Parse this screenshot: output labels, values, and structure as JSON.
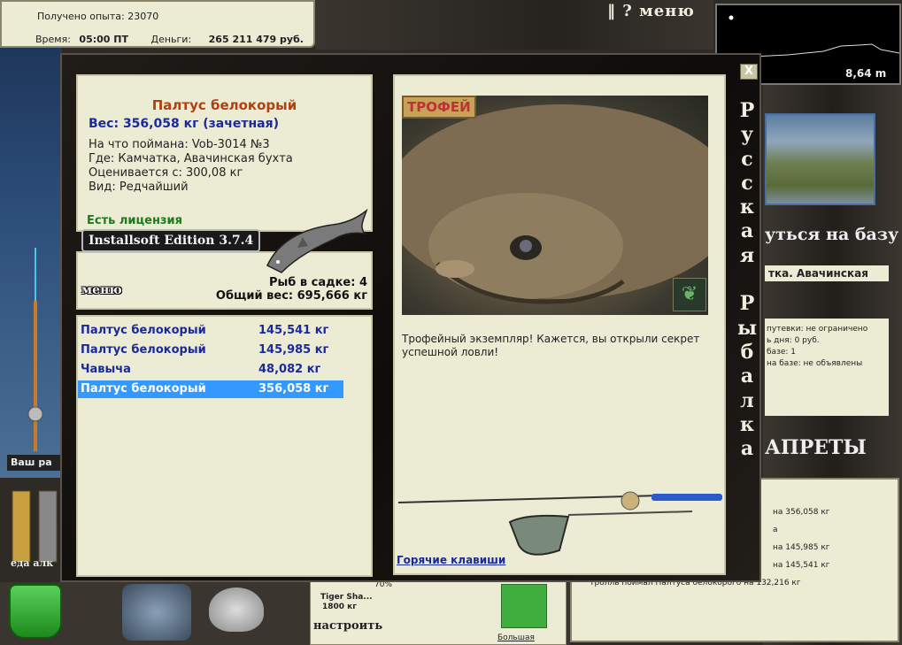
{
  "status": {
    "experience_label": "Получено опыта:",
    "experience_value": "23070",
    "time_label": "Время:",
    "time_value": "05:00 ПТ",
    "money_label": "Деньги:",
    "money_value": "265 211 479 руб."
  },
  "top_menu": {
    "menu_label": "‖ ? меню"
  },
  "depth": {
    "value": "8,64 m"
  },
  "right_panel": {
    "return_base": "уться на базу",
    "location": "тка. Авачинская",
    "details": [
      "путевки: не ограничено",
      "ь дня: 0 руб.",
      "базе: 1",
      "на базе: не объявлены"
    ],
    "bans_title": "АПРЕТЫ",
    "news": [
      "на 356,058 кг",
      "а",
      "на 145,985 кг",
      "на 145,541 кг",
      "Тролль поймал Палтуса белокорого на 132,216 кг"
    ]
  },
  "bottom": {
    "food_label": "еда",
    "alc_label": "алк",
    "our_label": "Ваш ра",
    "lure_name": "Tiger Sha...",
    "lure_weight": "1800 кг",
    "lure_pct": "70%",
    "tune_label": "настроить",
    "lure_size": "Большая"
  },
  "dialog": {
    "close_label": "X",
    "fish_name": "Палтус белокорый",
    "weight_line": "Вес: 356,058 кг (зачетная)",
    "caught_with": "На что поймана: Vob-3014 №3",
    "where": "Где: Камчатка, Авачинская бухта",
    "valued": "Оценивается с: 300,08 кг",
    "kind": "Вид: Редчайший",
    "license": "Есть лицензия",
    "edition": "Installsoft Edition 3.7.4",
    "menu_button": "меню",
    "fish_count": "Рыб в садке: 4",
    "total_weight": "Общий вес: 695,666 кг",
    "catches": [
      {
        "name": "Палтус белокорый",
        "weight": "145,541 кг"
      },
      {
        "name": "Палтус белокорый",
        "weight": "145,985 кг"
      },
      {
        "name": "Чавыча",
        "weight": "48,082 кг"
      },
      {
        "name": "Палтус белокорый",
        "weight": "356,058 кг"
      }
    ],
    "trophy_badge": "ТРОФЕЙ",
    "trophy_text": "Трофейный экземпляр! Кажется, вы открыли секрет успешной ловли!",
    "hotkeys": "Горячие клавиши",
    "vertical_title": [
      "Р",
      "у",
      "с",
      "с",
      "к",
      "а",
      "я",
      "",
      "Р",
      "ы",
      "б",
      "а",
      "л",
      "к",
      "а"
    ]
  }
}
